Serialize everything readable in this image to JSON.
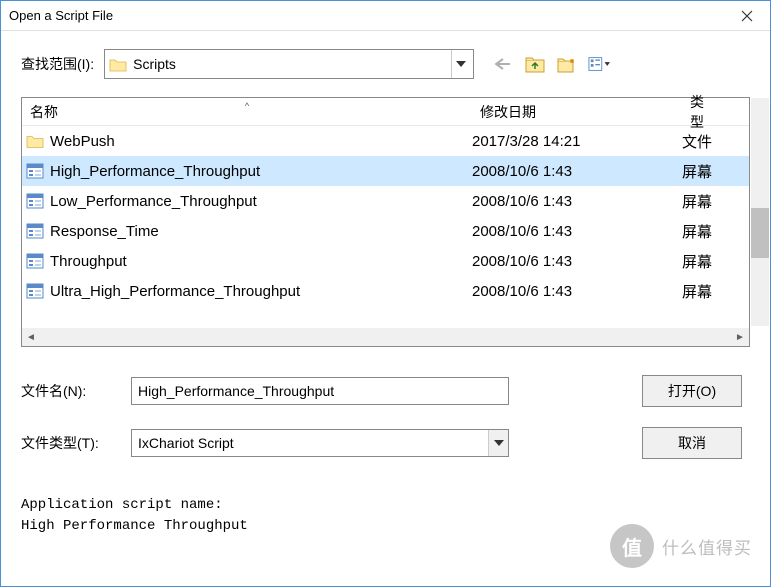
{
  "window": {
    "title": "Open a Script File"
  },
  "lookIn": {
    "label": "查找范围(I):",
    "value": "Scripts"
  },
  "columns": {
    "name": "名称",
    "date": "修改日期",
    "type": "类型"
  },
  "files": [
    {
      "icon": "folder",
      "name": "WebPush",
      "date": "2017/3/28 14:21",
      "type": "文件",
      "selected": false
    },
    {
      "icon": "script",
      "name": "High_Performance_Throughput",
      "date": "2008/10/6 1:43",
      "type": "屏幕",
      "selected": true
    },
    {
      "icon": "script",
      "name": "Low_Performance_Throughput",
      "date": "2008/10/6 1:43",
      "type": "屏幕",
      "selected": false
    },
    {
      "icon": "script",
      "name": "Response_Time",
      "date": "2008/10/6 1:43",
      "type": "屏幕",
      "selected": false
    },
    {
      "icon": "script",
      "name": "Throughput",
      "date": "2008/10/6 1:43",
      "type": "屏幕",
      "selected": false
    },
    {
      "icon": "script",
      "name": "Ultra_High_Performance_Throughput",
      "date": "2008/10/6 1:43",
      "type": "屏幕",
      "selected": false
    }
  ],
  "filename": {
    "label": "文件名(N):",
    "value": "High_Performance_Throughput"
  },
  "filetype": {
    "label": "文件类型(T):",
    "value": "IxChariot Script"
  },
  "buttons": {
    "open": "打开(O)",
    "cancel": "取消"
  },
  "scriptInfo": {
    "label": "Application script name:",
    "value": "High Performance Throughput"
  },
  "watermark": {
    "badge": "值",
    "text": "什么值得买"
  }
}
